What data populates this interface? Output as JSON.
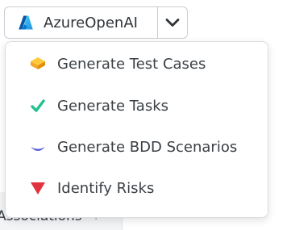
{
  "provider": {
    "label": "AzureOpenAI",
    "icon": "azure-icon",
    "accent": "#1f6feb"
  },
  "menu": {
    "items": [
      {
        "label": "Generate Test Cases",
        "icon": "cube-icon",
        "color": "#f5a623"
      },
      {
        "label": "Generate Tasks",
        "icon": "checkmark-icon",
        "color": "#22c18f"
      },
      {
        "label": "Generate BDD Scenarios",
        "icon": "smile-curve-icon",
        "color": "#5b5fd6"
      },
      {
        "label": "Identify Risks",
        "icon": "warning-triangle-icon",
        "color": "#e0333e"
      }
    ]
  },
  "background": {
    "tab_label": "Associations",
    "tab_plus": "+"
  }
}
